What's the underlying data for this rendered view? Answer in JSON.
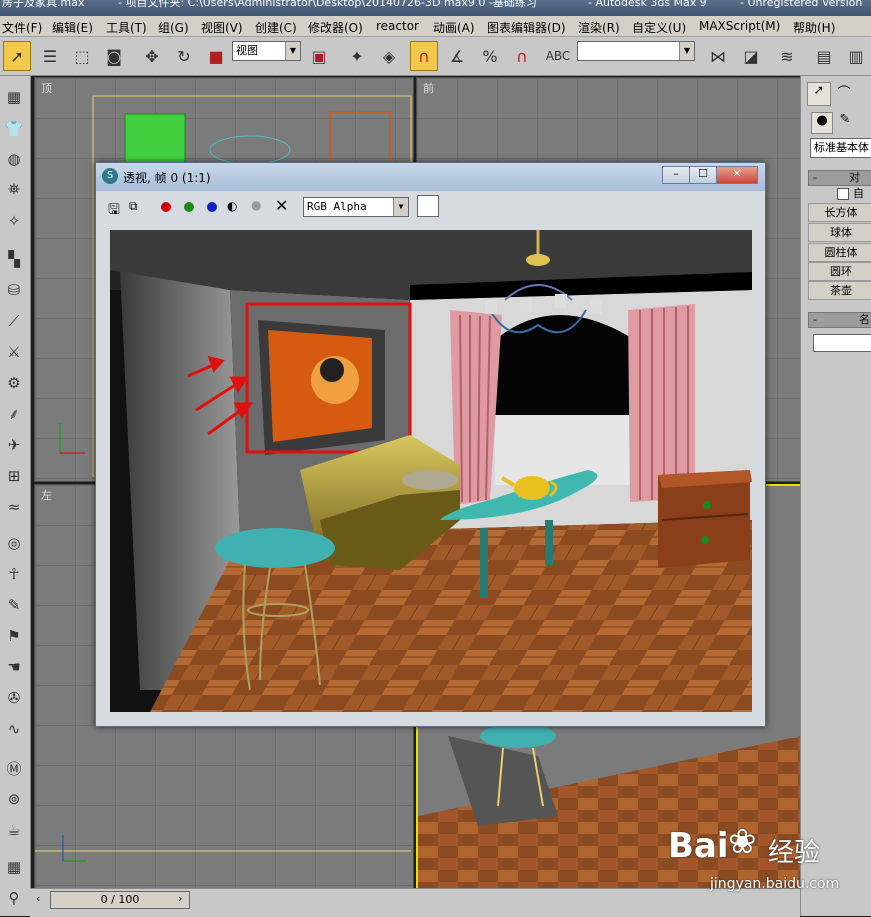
{
  "app": {
    "title_parts": [
      "房子及家具.max",
      "- 项目文件夹: C:\\Users\\Administrator\\Desktop\\20140726-3D max9.0 -基础练习",
      "- Autodesk 3ds Max 9",
      "- Unregistered Version"
    ]
  },
  "menu": [
    "文件(F)",
    "编辑(E)",
    "工具(T)",
    "组(G)",
    "视图(V)",
    "创建(C)",
    "修改器(O)",
    "reactor",
    "动画(A)",
    "图表编辑器(D)",
    "渲染(R)",
    "自定义(U)",
    "MAXScript(M)",
    "帮助(H)"
  ],
  "toolbar": {
    "ref_coord": "视图",
    "named_selection": "",
    "abc_label": "ABC"
  },
  "viewports": {
    "top": "顶",
    "front": "前",
    "left": "左",
    "perspective": "透视"
  },
  "render_window": {
    "title": "透视, 帧 0 (1:1)",
    "channel": "RGB Alpha",
    "channel_dots": [
      "#d00000",
      "#1a8a1a",
      "#1020c0"
    ]
  },
  "command_panel": {
    "category": "标准基本体",
    "rollup_object_type": "对",
    "autogrid": "自",
    "buttons": [
      "长方体",
      "球体",
      "圆柱体",
      "圆环",
      "茶壶"
    ],
    "rollup_name": "名"
  },
  "timeline": {
    "frame": "0 / 100"
  },
  "watermark": {
    "brand": "Bai",
    "brand_suffix": "经验",
    "url": "jingyan.baidu.com"
  },
  "colors": {
    "accent_yellow": "#f2c94c",
    "annotation_red": "#e01010",
    "viewport_bg": "#7b7b7b"
  }
}
